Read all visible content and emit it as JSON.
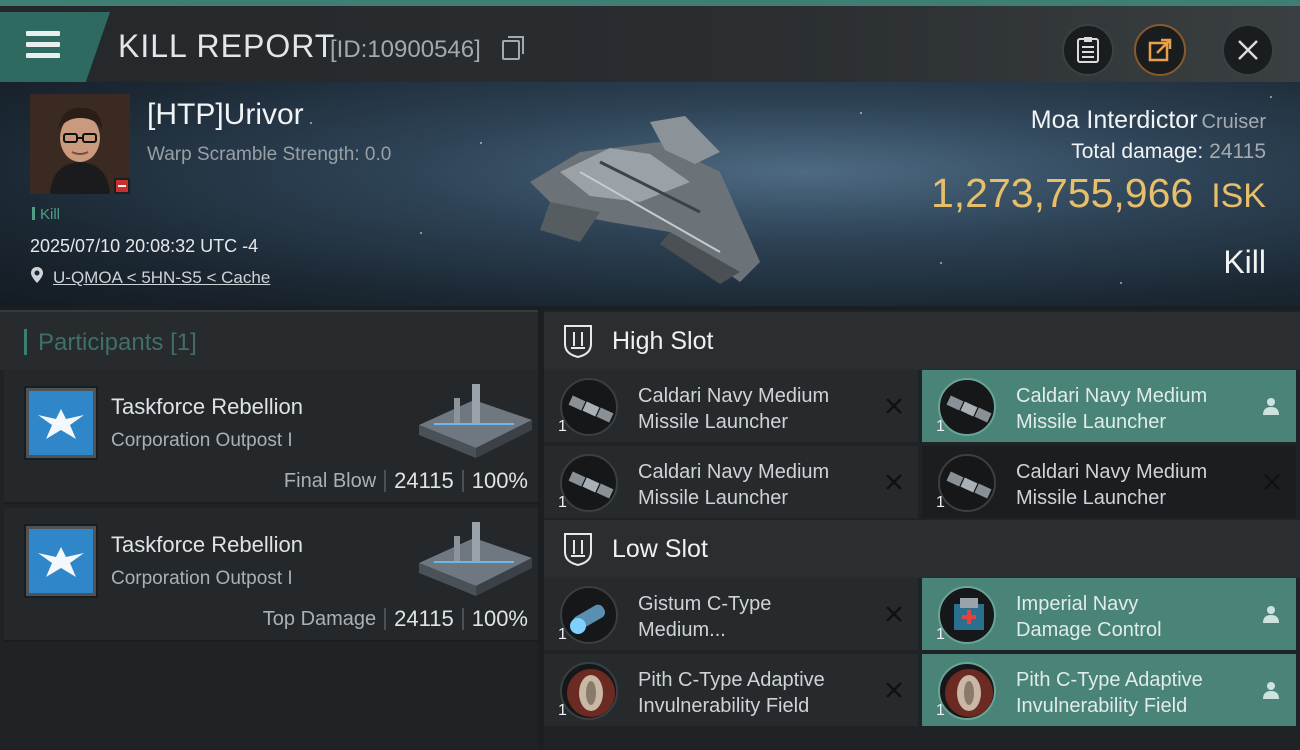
{
  "header": {
    "title": "KILL REPORT",
    "report_id": "[ID:10900546]",
    "buttons": {
      "menu": "menu-icon",
      "clipboard": "clipboard-icon",
      "share": "share-icon",
      "close": "close-icon"
    }
  },
  "victim": {
    "name": "[HTP]Urivor",
    "warp_scramble": "Warp Scramble Strength: 0.0",
    "kill_tag": "Kill",
    "datetime": "2025/07/10 20:08:32 UTC -4",
    "location": "U-QMOA < 5HN-S5 < Cache",
    "ship_name": "Moa Interdictor",
    "ship_class": "Cruiser",
    "total_damage_label": "Total damage:",
    "total_damage": "24115",
    "isk_value": "1,273,755,966",
    "isk_unit": "ISK",
    "result": "Kill"
  },
  "participants": {
    "label": "Participants",
    "count": "[1]",
    "items": [
      {
        "name": "Taskforce Rebellion",
        "type": "Corporation Outpost I",
        "role": "Final Blow",
        "damage": "24115",
        "percent": "100%"
      },
      {
        "name": "Taskforce Rebellion",
        "type": "Corporation Outpost I",
        "role": "Top Damage",
        "damage": "24115",
        "percent": "100%"
      }
    ]
  },
  "slots": {
    "high": {
      "label": "High Slot",
      "modules": [
        {
          "line1": "Caldari Navy Medium",
          "line2": "Missile Launcher",
          "qty": "1",
          "status": "destroyed"
        },
        {
          "line1": "Caldari Navy Medium",
          "line2": "Missile Launcher",
          "qty": "1",
          "status": "dropped"
        },
        {
          "line1": "Caldari Navy Medium",
          "line2": "Missile Launcher",
          "qty": "1",
          "status": "destroyed"
        },
        {
          "line1": "Caldari Navy Medium",
          "line2": "Missile Launcher",
          "qty": "1",
          "status": "destroyed"
        }
      ]
    },
    "low": {
      "label": "Low Slot",
      "modules": [
        {
          "line1": "Gistum C-Type",
          "line2": "Medium...",
          "qty": "1",
          "status": "destroyed"
        },
        {
          "line1": "Imperial Navy",
          "line2": "Damage Control",
          "qty": "1",
          "status": "dropped"
        },
        {
          "line1": "Pith C-Type Adaptive",
          "line2": "Invulnerability Field",
          "qty": "1",
          "status": "destroyed"
        },
        {
          "line1": "Pith C-Type Adaptive",
          "line2": "Invulnerability Field",
          "qty": "1",
          "status": "dropped"
        }
      ]
    }
  },
  "colors": {
    "accent": "#3f7f73",
    "fitted": "#4a8378",
    "isk": "#e7bf6b"
  }
}
